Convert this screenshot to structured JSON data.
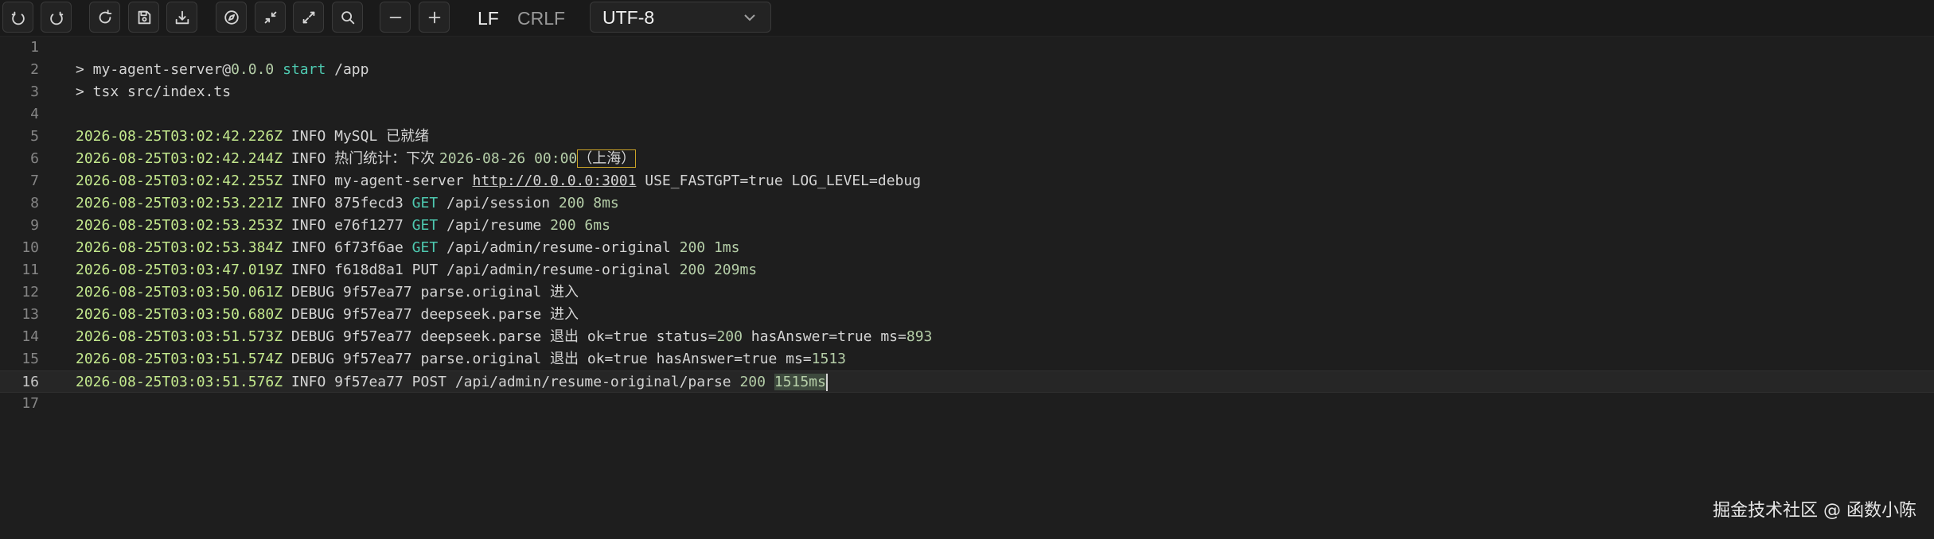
{
  "toolbar": {
    "buttons": [
      {
        "name": "undo-icon"
      },
      {
        "name": "redo-icon"
      },
      {
        "name": "reload-icon"
      },
      {
        "name": "save-icon"
      },
      {
        "name": "download-icon"
      },
      {
        "name": "compass-icon"
      },
      {
        "name": "minimize-icon"
      },
      {
        "name": "maximize-icon"
      },
      {
        "name": "search-icon"
      },
      {
        "name": "zoom-out-icon"
      },
      {
        "name": "zoom-in-icon"
      }
    ],
    "eol_lf": "LF",
    "eol_crlf": "CRLF",
    "encoding": "UTF-8"
  },
  "editor": {
    "active_line": 16,
    "lines": [
      {
        "n": "1",
        "segs": []
      },
      {
        "n": "2",
        "segs": [
          {
            "t": "> my-agent-server@"
          },
          {
            "t": "0.0.0",
            "c": "num"
          },
          {
            "t": " "
          },
          {
            "t": "start",
            "c": "green"
          },
          {
            "t": " /app"
          }
        ]
      },
      {
        "n": "3",
        "segs": [
          {
            "t": "> tsx src/index.ts"
          }
        ]
      },
      {
        "n": "4",
        "segs": []
      },
      {
        "n": "5",
        "segs": [
          {
            "t": "2026-08-25T03:02:42.226Z",
            "c": "ts"
          },
          {
            "t": " INFO MySQL "
          },
          {
            "t": "已就绪",
            "c": "cjk"
          }
        ]
      },
      {
        "n": "6",
        "segs": [
          {
            "t": "2026-08-25T03:02:42.244Z",
            "c": "ts"
          },
          {
            "t": " INFO "
          },
          {
            "t": "热门统计：下次 ",
            "c": "cjk"
          },
          {
            "t": "2026-08-26 00:00",
            "c": "num"
          },
          {
            "t": "（上海）",
            "c": "cjk box"
          }
        ]
      },
      {
        "n": "7",
        "segs": [
          {
            "t": "2026-08-25T03:02:42.255Z",
            "c": "ts"
          },
          {
            "t": " INFO my-agent-server "
          },
          {
            "t": "http://0.0.0.0:3001",
            "c": "url"
          },
          {
            "t": " USE_FASTGPT=true LOG_LEVEL=debug"
          }
        ]
      },
      {
        "n": "8",
        "segs": [
          {
            "t": "2026-08-25T03:02:53.221Z",
            "c": "ts"
          },
          {
            "t": " INFO 875fecd3 "
          },
          {
            "t": "GET",
            "c": "green"
          },
          {
            "t": " /api/session "
          },
          {
            "t": "200",
            "c": "num"
          },
          {
            "t": " "
          },
          {
            "t": "8ms",
            "c": "num"
          }
        ]
      },
      {
        "n": "9",
        "segs": [
          {
            "t": "2026-08-25T03:02:53.253Z",
            "c": "ts"
          },
          {
            "t": " INFO e76f1277 "
          },
          {
            "t": "GET",
            "c": "green"
          },
          {
            "t": " /api/resume "
          },
          {
            "t": "200",
            "c": "num"
          },
          {
            "t": " "
          },
          {
            "t": "6ms",
            "c": "num"
          }
        ]
      },
      {
        "n": "10",
        "segs": [
          {
            "t": "2026-08-25T03:02:53.384Z",
            "c": "ts"
          },
          {
            "t": " INFO 6f73f6ae "
          },
          {
            "t": "GET",
            "c": "green"
          },
          {
            "t": " /api/admin/resume-original "
          },
          {
            "t": "200",
            "c": "num"
          },
          {
            "t": " "
          },
          {
            "t": "1ms",
            "c": "num"
          }
        ]
      },
      {
        "n": "11",
        "segs": [
          {
            "t": "2026-08-25T03:03:47.019Z",
            "c": "ts"
          },
          {
            "t": " INFO f618d8a1 PUT /api/admin/resume-original "
          },
          {
            "t": "200",
            "c": "num"
          },
          {
            "t": " "
          },
          {
            "t": "209ms",
            "c": "num"
          }
        ]
      },
      {
        "n": "12",
        "segs": [
          {
            "t": "2026-08-25T03:03:50.061Z",
            "c": "ts"
          },
          {
            "t": " DEBUG 9f57ea77 parse.original "
          },
          {
            "t": "进入",
            "c": "cjk"
          }
        ]
      },
      {
        "n": "13",
        "segs": [
          {
            "t": "2026-08-25T03:03:50.680Z",
            "c": "ts"
          },
          {
            "t": " DEBUG 9f57ea77 deepseek.parse "
          },
          {
            "t": "进入",
            "c": "cjk"
          }
        ]
      },
      {
        "n": "14",
        "segs": [
          {
            "t": "2026-08-25T03:03:51.573Z",
            "c": "ts"
          },
          {
            "t": " DEBUG 9f57ea77 deepseek.parse "
          },
          {
            "t": "退出",
            "c": "cjk"
          },
          {
            "t": " ok=true status="
          },
          {
            "t": "200",
            "c": "num"
          },
          {
            "t": " hasAnswer=true ms="
          },
          {
            "t": "893",
            "c": "num"
          }
        ]
      },
      {
        "n": "15",
        "segs": [
          {
            "t": "2026-08-25T03:03:51.574Z",
            "c": "ts"
          },
          {
            "t": " DEBUG 9f57ea77 parse.original "
          },
          {
            "t": "退出",
            "c": "cjk"
          },
          {
            "t": " ok=true hasAnswer=true ms="
          },
          {
            "t": "1513",
            "c": "num"
          }
        ]
      },
      {
        "n": "16",
        "segs": [
          {
            "t": "2026-08-25T03:03:51.576Z",
            "c": "ts"
          },
          {
            "t": " INFO 9f57ea77 POST /api/admin/resume-original/parse "
          },
          {
            "t": "200",
            "c": "num"
          },
          {
            "t": " "
          },
          {
            "t": "1515ms",
            "c": "num sel"
          }
        ]
      },
      {
        "n": "17",
        "segs": []
      }
    ]
  },
  "watermark": "掘金技术社区 @ 函数小陈"
}
